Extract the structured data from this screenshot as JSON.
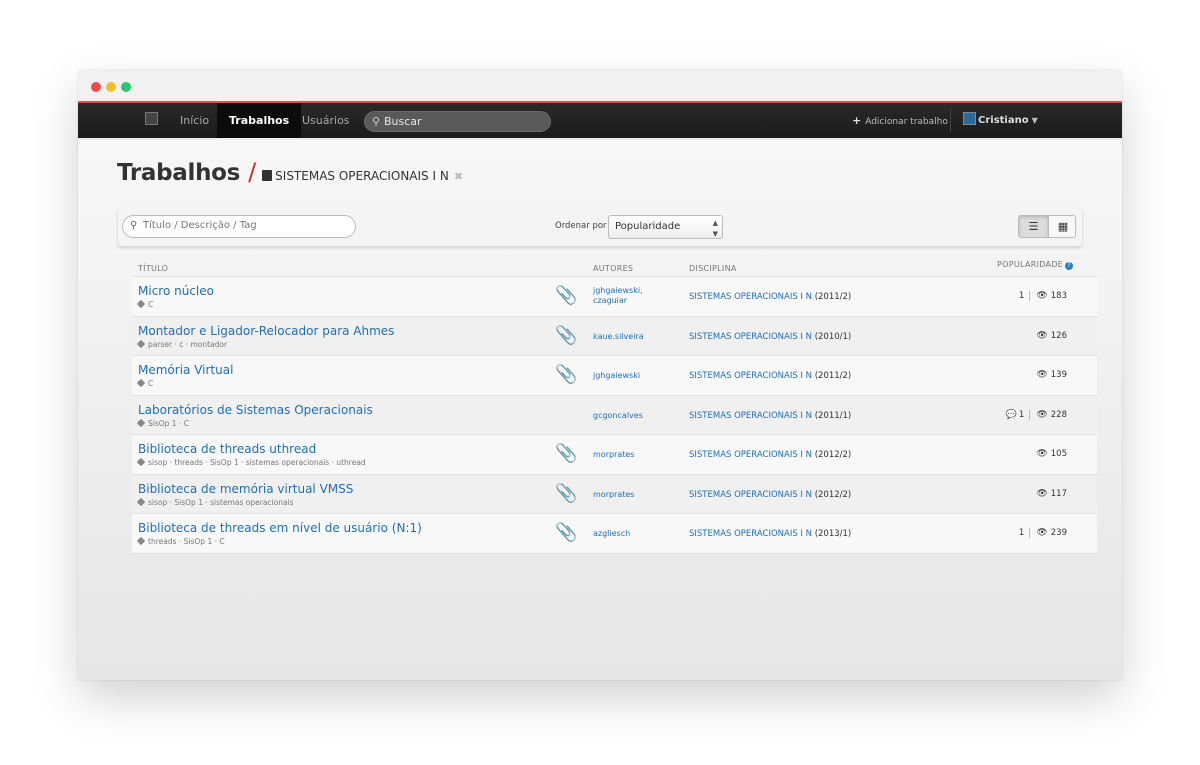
{
  "navbar": {
    "items": [
      {
        "label": "Início",
        "active": false
      },
      {
        "label": "Trabalhos",
        "active": true
      },
      {
        "label": "Usuários",
        "active": false
      }
    ],
    "search_placeholder": "Buscar",
    "add_label": "Adicionar trabalho",
    "user_name": "Cristiano"
  },
  "header": {
    "title": "Trabalhos",
    "separator": "/",
    "filter_label": "SISTEMAS OPERACIONAIS I N"
  },
  "toolbar": {
    "search_placeholder": "Título / Descrição / Tag",
    "order_label": "Ordenar por",
    "order_value": "Popularidade"
  },
  "table": {
    "headers": {
      "title": "TÍTULO",
      "authors": "AUTORES",
      "discipline": "DISCIPLINA",
      "popularity": "POPULARIDADE"
    },
    "rows": [
      {
        "title": "Micro núcleo",
        "tags": "C",
        "authors": [
          "jghgaiewski,",
          "czaguiar"
        ],
        "discipline": "SISTEMAS OPERACIONAIS I N",
        "term": "(2011/2)",
        "likes": "1",
        "comments": "",
        "views": "183",
        "attachment": true
      },
      {
        "title": "Montador e Ligador-Relocador para Ahmes",
        "tags": "parser · c · montador",
        "authors": [
          "kaue.silveira"
        ],
        "discipline": "SISTEMAS OPERACIONAIS I N",
        "term": "(2010/1)",
        "likes": "",
        "comments": "",
        "views": "126",
        "attachment": true
      },
      {
        "title": "Memória Virtual",
        "tags": "C",
        "authors": [
          "jghgaiewski"
        ],
        "discipline": "SISTEMAS OPERACIONAIS I N",
        "term": "(2011/2)",
        "likes": "",
        "comments": "",
        "views": "139",
        "attachment": true
      },
      {
        "title": "Laboratórios de Sistemas Operacionais",
        "tags": "SisOp 1 · C",
        "authors": [
          "gcgoncalves"
        ],
        "discipline": "SISTEMAS OPERACIONAIS I N",
        "term": "(2011/1)",
        "likes": "",
        "comments": "1",
        "views": "228",
        "attachment": false
      },
      {
        "title": "Biblioteca de threads uthread",
        "tags": "sisop · threads · SisOp 1 · sistemas operacionais · uthread",
        "authors": [
          "morprates"
        ],
        "discipline": "SISTEMAS OPERACIONAIS I N",
        "term": "(2012/2)",
        "likes": "",
        "comments": "",
        "views": "105",
        "attachment": true
      },
      {
        "title": "Biblioteca de memória virtual VMSS",
        "tags": "sisop · SisOp 1 · sistemas operacionais",
        "authors": [
          "morprates"
        ],
        "discipline": "SISTEMAS OPERACIONAIS I N",
        "term": "(2012/2)",
        "likes": "",
        "comments": "",
        "views": "117",
        "attachment": true
      },
      {
        "title": "Biblioteca de threads em nível de usuário (N:1)",
        "tags": "threads · SisOp 1 · C",
        "authors": [
          "azgliesch"
        ],
        "discipline": "SISTEMAS OPERACIONAIS I N",
        "term": "(2013/1)",
        "likes": "1",
        "comments": "",
        "views": "239",
        "attachment": true
      }
    ]
  }
}
